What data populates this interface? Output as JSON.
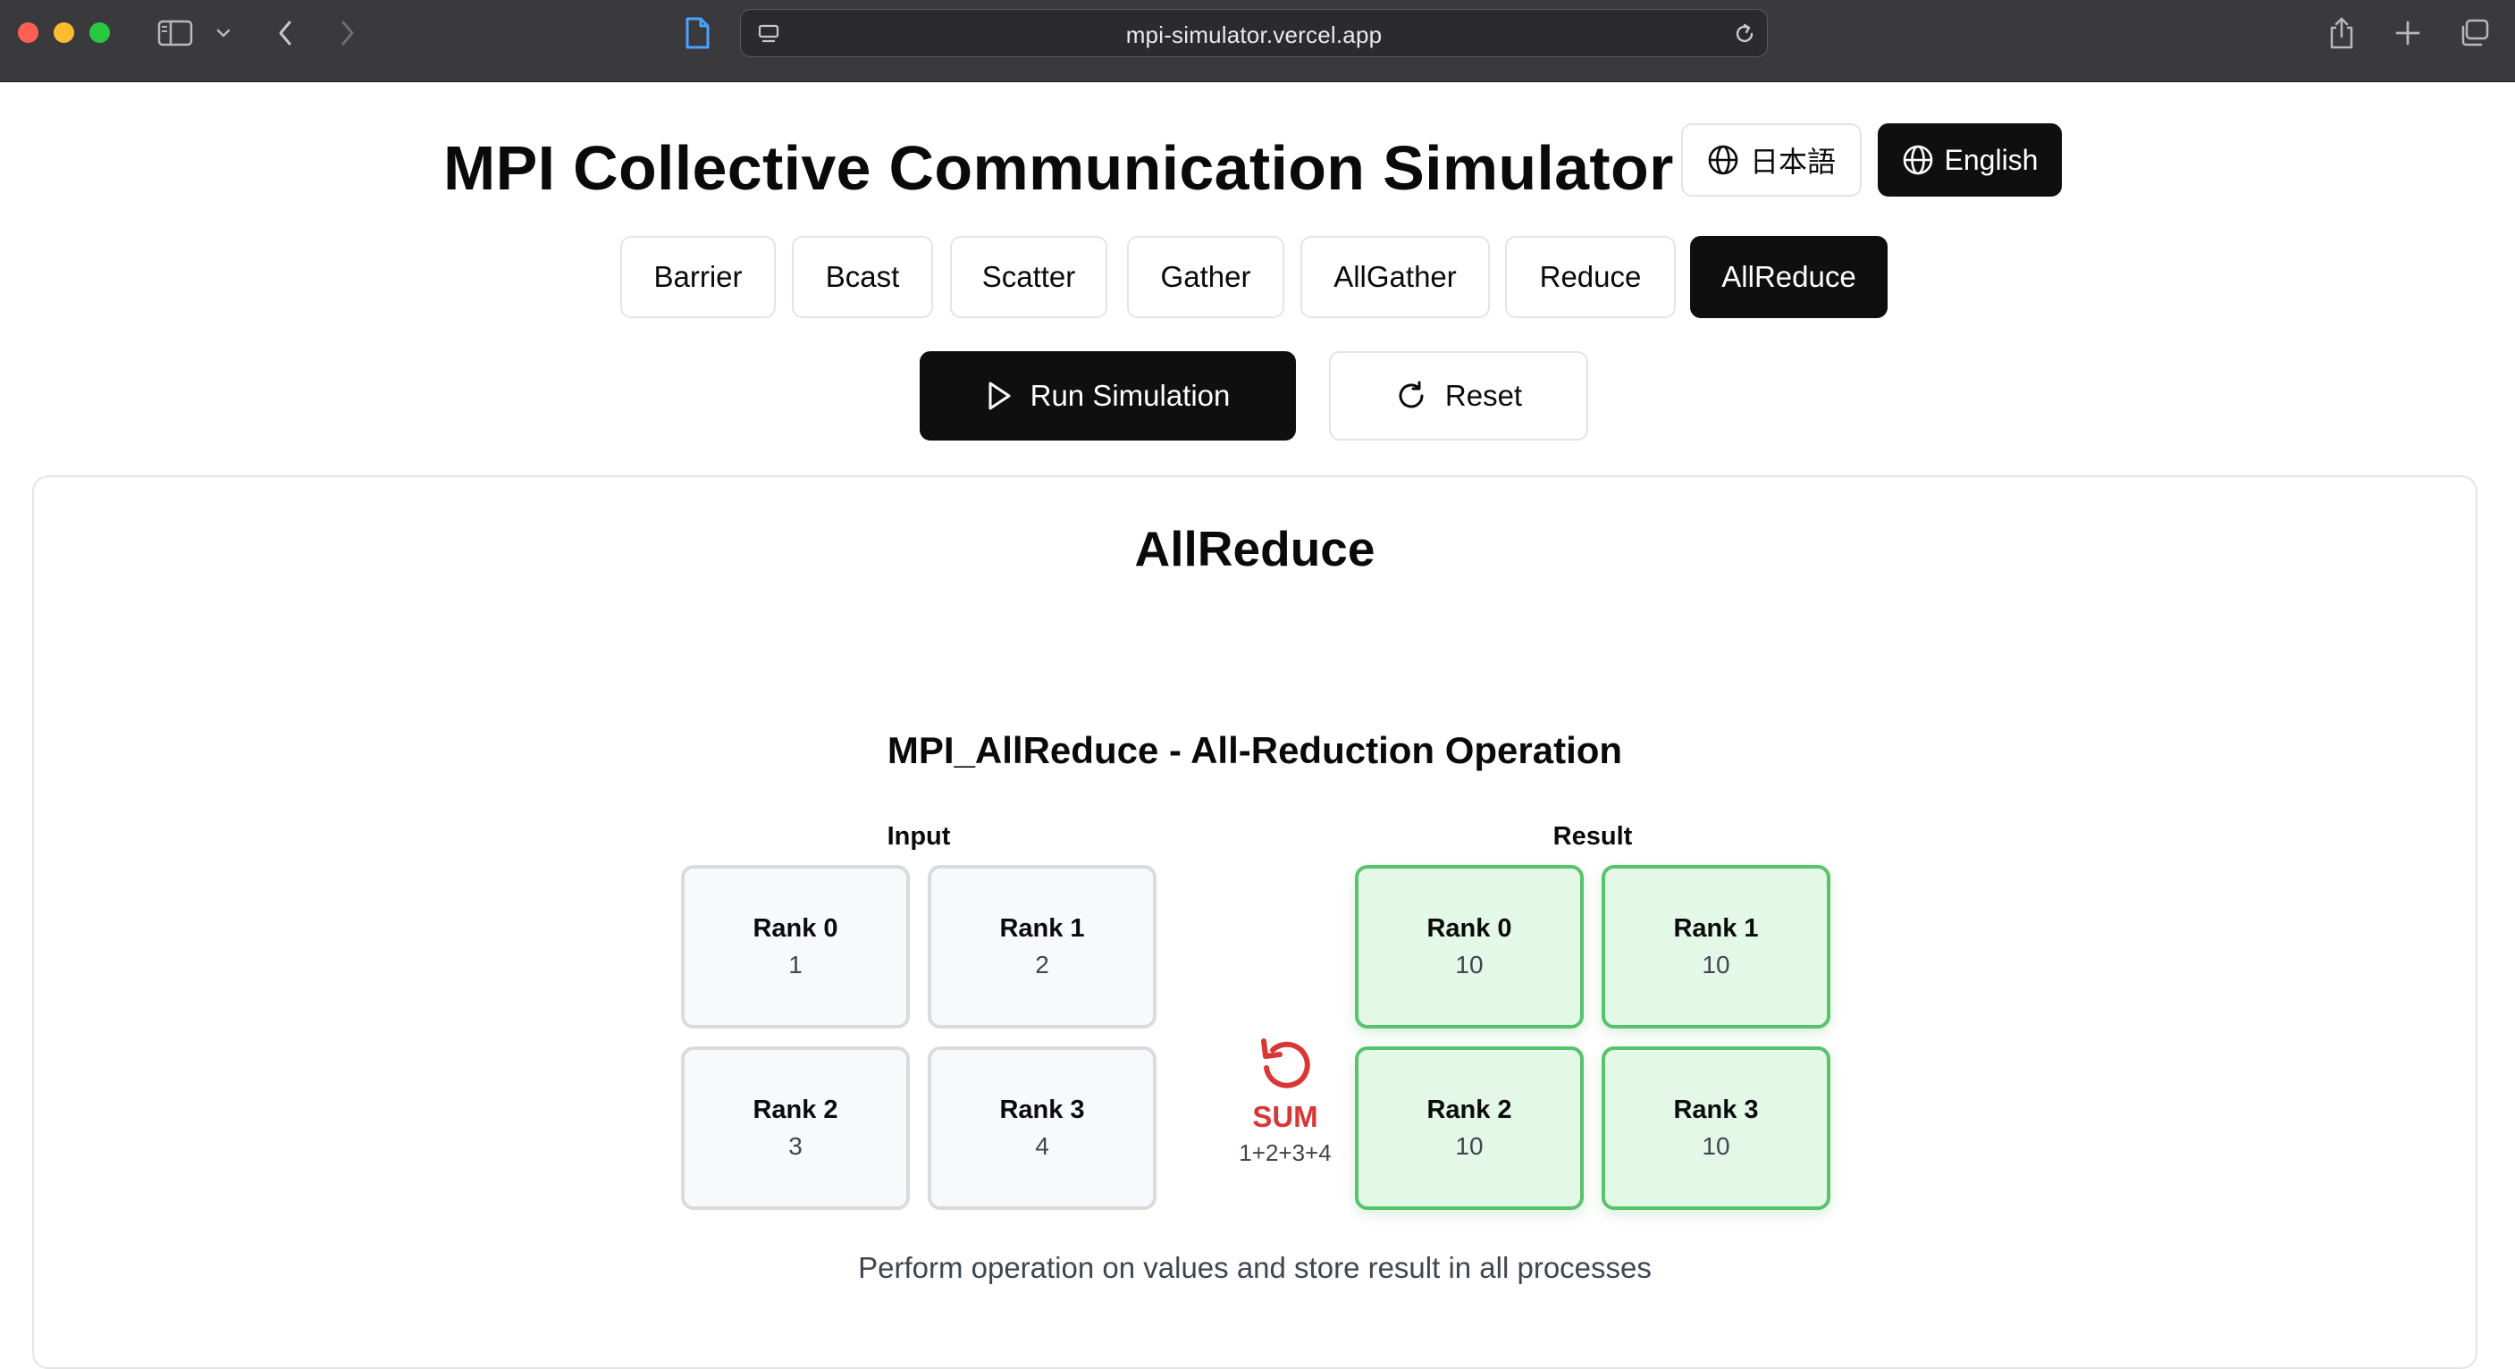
{
  "browser": {
    "url": "mpi-simulator.vercel.app",
    "icons": [
      "sidebar-icon",
      "chevron-down-icon",
      "back-icon",
      "forward-icon",
      "page-icon",
      "tab-icon",
      "reload-icon",
      "share-icon",
      "new-tab-icon",
      "tabs-overview-icon"
    ]
  },
  "header": {
    "title": "MPI Collective Communication Simulator",
    "lang_ja": "日本語",
    "lang_en": "English"
  },
  "tabs": [
    {
      "label": "Barrier",
      "active": false
    },
    {
      "label": "Bcast",
      "active": false
    },
    {
      "label": "Scatter",
      "active": false
    },
    {
      "label": "Gather",
      "active": false
    },
    {
      "label": "AllGather",
      "active": false
    },
    {
      "label": "Reduce",
      "active": false
    },
    {
      "label": "AllReduce",
      "active": true
    }
  ],
  "actions": {
    "run_label": "Run Simulation",
    "reset_label": "Reset"
  },
  "visualization": {
    "card_title": "AllReduce",
    "title": "MPI_AllReduce - All-Reduction Operation",
    "input_label": "Input",
    "result_label": "Result",
    "inputs": [
      {
        "name": "Rank 0",
        "value": "1"
      },
      {
        "name": "Rank 1",
        "value": "2"
      },
      {
        "name": "Rank 2",
        "value": "3"
      },
      {
        "name": "Rank 3",
        "value": "4"
      }
    ],
    "operation": {
      "name": "SUM",
      "expression": "1+2+3+4",
      "icon": "rotate-ccw-icon"
    },
    "results": [
      {
        "name": "Rank 0",
        "value": "10"
      },
      {
        "name": "Rank 1",
        "value": "10"
      },
      {
        "name": "Rank 2",
        "value": "10"
      },
      {
        "name": "Rank 3",
        "value": "10"
      }
    ],
    "description": "Perform operation on values and store result in all processes"
  },
  "colors": {
    "accent_dark": "#0f0f10",
    "result_fill": "#e4f8e8",
    "result_border": "#56c46a",
    "operation_red": "#d93636"
  }
}
